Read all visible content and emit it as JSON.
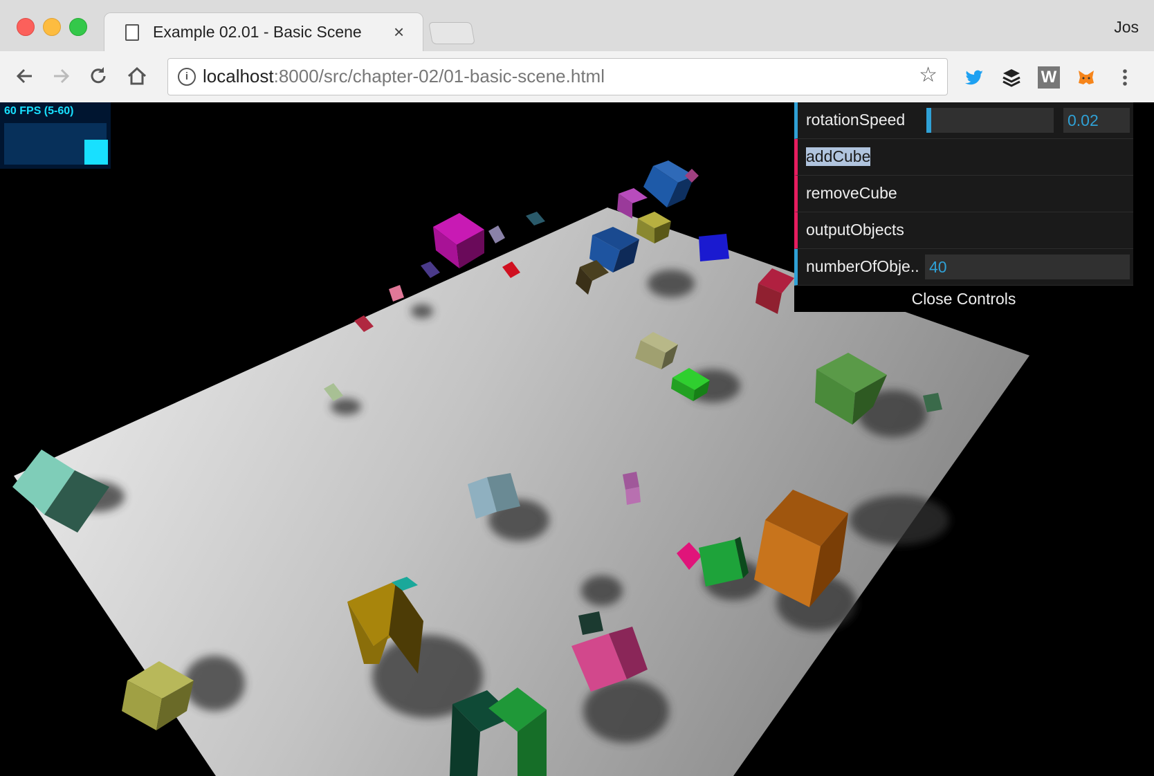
{
  "browser": {
    "tab_title": "Example 02.01 - Basic Scene",
    "tab_close": "×",
    "profile": "Jos",
    "url_host": "localhost",
    "url_rest": ":8000/src/chapter-02/01-basic-scene.html",
    "icons": [
      "back-icon",
      "forward-icon",
      "reload-icon",
      "home-icon",
      "info-icon",
      "bookmark-star-icon",
      "twitter-icon",
      "buffer-icon",
      "w-extension-icon",
      "metamask-icon",
      "menu-icon"
    ],
    "ext_w_label": "W"
  },
  "stats": {
    "label": "60 FPS (5-60)"
  },
  "gui": {
    "controls": [
      {
        "label": "rotationSpeed",
        "type": "number",
        "value": "0.02",
        "fraction": 0.02
      },
      {
        "label": "addCube",
        "type": "function"
      },
      {
        "label": "removeCube",
        "type": "function"
      },
      {
        "label": "outputObjects",
        "type": "function"
      },
      {
        "label": "numberOfObje..",
        "type": "number",
        "value": "40"
      }
    ],
    "close_label": "Close Controls"
  },
  "colors": {
    "gui_number": "#2fa1d6",
    "gui_function": "#e61d5f",
    "stats_text": "#18e0ff"
  }
}
